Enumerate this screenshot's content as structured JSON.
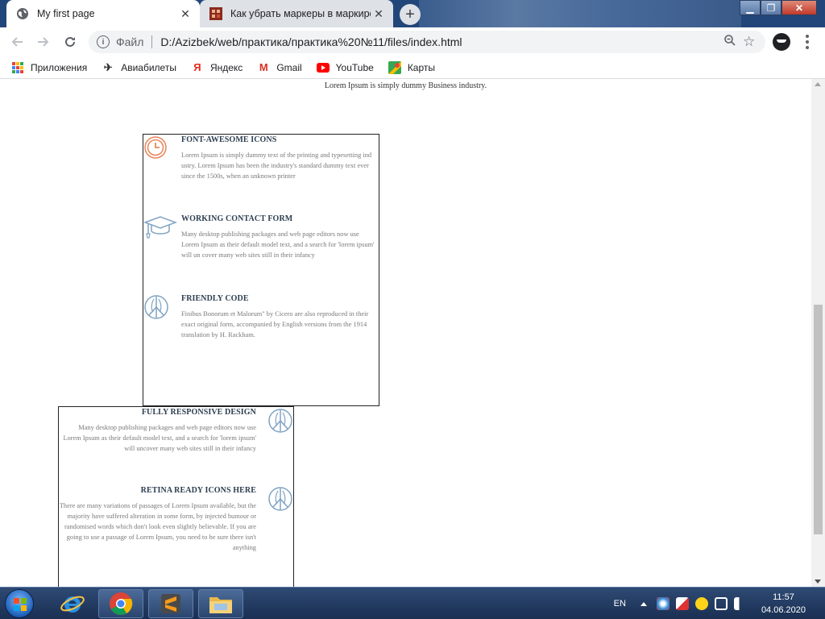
{
  "browser": {
    "tabs": [
      {
        "title": "My first page",
        "active": true
      },
      {
        "title": "Как убрать маркеры в маркирован",
        "active": false
      }
    ],
    "new_tab_label": "+",
    "address": {
      "scheme_label": "Файл",
      "url": "D:/Azizbek/web/практика/практика%20№11/files/index.html"
    },
    "bookmarks": [
      {
        "label": "Приложения",
        "icon": "apps-grid-icon"
      },
      {
        "label": "Авиабилеты",
        "icon": "airplane-icon"
      },
      {
        "label": "Яндекс",
        "icon": "yandex-icon"
      },
      {
        "label": "Gmail",
        "icon": "gmail-icon"
      },
      {
        "label": "YouTube",
        "icon": "youtube-icon"
      },
      {
        "label": "Карты",
        "icon": "maps-icon"
      }
    ]
  },
  "page": {
    "intro": "Lorem Ipsum is simply dummy Business industry.",
    "features_left": [
      {
        "title": "FONT-AWESOME ICONS",
        "icon": "clock-icon",
        "text": "Lorem Ipsum is simply dummy text of the printing and typesetting ind ustry. Lorem Ipsum has been the industry's standard dummy text ever since the 1500s, when an unknown printer"
      },
      {
        "title": "WORKING CONTACT FORM",
        "icon": "graduation-cap-icon",
        "text": "Many desktop publishing packages and web page editors now use Lorem Ipsum as their default model text, and a search for 'lorem ipsum' will un cover many web sites still in their infancy"
      },
      {
        "title": "FRIENDLY CODE",
        "icon": "peace-icon",
        "text": "Finibus Bonorum et Malorum\" by Cicero are also reproduced in their exact original form, accompanied by English versions from the 1914 translation by H. Rackham."
      }
    ],
    "features_right": [
      {
        "title": "FULLY RESPONSIVE DESIGN",
        "icon": "peace-icon",
        "text": "Many desktop publishing packages and web page editors now use Lorem Ipsum as their default model text, and a search for 'lorem ipsum' will uncover many web sites still in their infancy"
      },
      {
        "title": "RETINA READY ICONS HERE",
        "icon": "peace-icon",
        "text": "There are many variations of passages of Lorem Ipsum available, but the majority have suffered alteration in some form, by injected humour or randomised words which don't look even slightly believable. If you are going to use a passage of Lorem Ipsum, you need to be sure there isn't anything"
      }
    ]
  },
  "taskbar": {
    "language": "EN",
    "time": "11:57",
    "date": "04.06.2020"
  },
  "colors": {
    "clock_icon": "#e8855b",
    "line_icon": "#7fa3c2"
  }
}
